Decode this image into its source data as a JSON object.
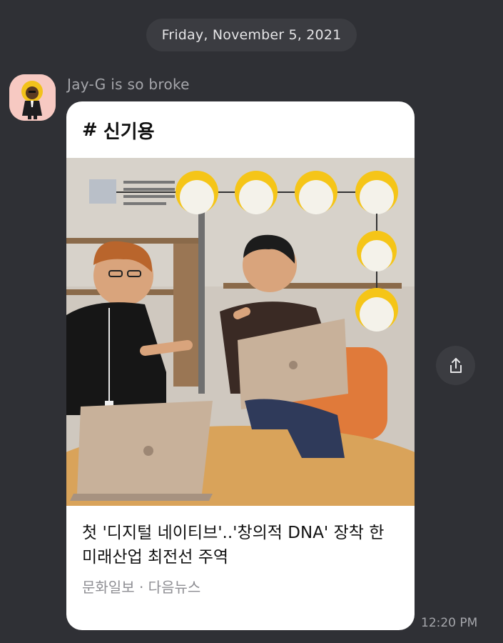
{
  "chat": {
    "date_label": "Friday, November 5, 2021",
    "sender_name": "Jay-G is so broke",
    "timestamp": "12:20 PM"
  },
  "card": {
    "hashtag_symbol": "#",
    "hashtag_label": "신기용",
    "title": "첫 '디지털 네이티브'..'창의적 DNA' 장착 한 미래산업 최전선 주역",
    "source": "문화일보 · 다음뉴스",
    "image_icon": "news-photo-two-men-with-laptops"
  },
  "icons": {
    "share": "share-icon",
    "avatar": "avatar-character-icon"
  },
  "colors": {
    "background": "#2f3035",
    "pill": "#3b3c41",
    "card": "#ffffff",
    "accent_yellow": "#f5c518"
  }
}
